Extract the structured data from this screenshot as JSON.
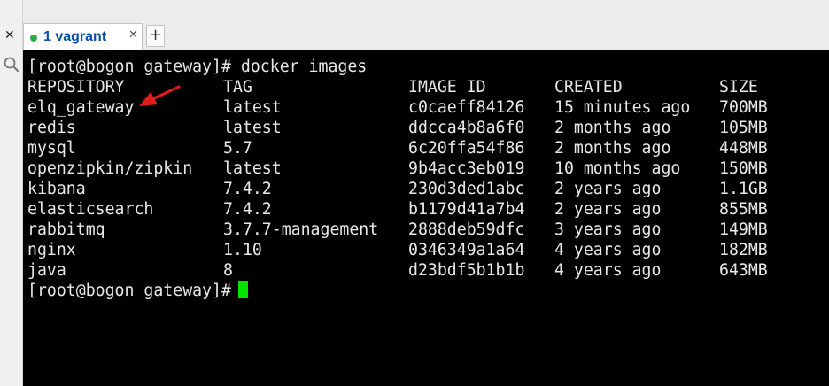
{
  "window": {
    "left_close_glyph": "✕",
    "tab": {
      "number": "1",
      "label": "vagrant",
      "close_glyph": "✕"
    },
    "add_tab_glyph": "+"
  },
  "terminal": {
    "command_line": "[root@bogon gateway]# docker images",
    "headers": [
      "REPOSITORY",
      "TAG",
      "IMAGE ID",
      "CREATED",
      "SIZE"
    ],
    "rows": [
      [
        "elq_gateway",
        "latest",
        "c0caeff84126",
        "15 minutes ago",
        "700MB"
      ],
      [
        "redis",
        "latest",
        "ddcca4b8a6f0",
        "2 months ago",
        "105MB"
      ],
      [
        "mysql",
        "5.7",
        "6c20ffa54f86",
        "2 months ago",
        "448MB"
      ],
      [
        "openzipkin/zipkin",
        "latest",
        "9b4acc3eb019",
        "10 months ago",
        "150MB"
      ],
      [
        "kibana",
        "7.4.2",
        "230d3ded1abc",
        "2 years ago",
        "1.1GB"
      ],
      [
        "elasticsearch",
        "7.4.2",
        "b1179d41a7b4",
        "2 years ago",
        "855MB"
      ],
      [
        "rabbitmq",
        "3.7.7-management",
        "2888deb59dfc",
        "3 years ago",
        "149MB"
      ],
      [
        "nginx",
        "1.10",
        "0346349a1a64",
        "4 years ago",
        "182MB"
      ],
      [
        "java",
        "8",
        "d23bdf5b1b1b",
        "4 years ago",
        "643MB"
      ]
    ],
    "prompt": "[root@bogon gateway]#"
  },
  "colors": {
    "terminal_bg": "#000000",
    "terminal_fg": "#e8e8e8",
    "cursor": "#00e400",
    "annotation_arrow": "#e21b1b",
    "tab_text": "#0a4fa6",
    "status_dot": "#22b14c"
  },
  "icons": {
    "left_close": "close-icon",
    "search": "search-icon",
    "tab_status": "status-dot-icon",
    "tab_close": "close-icon",
    "add_tab": "plus-icon",
    "annotation": "red-arrow-annotation"
  }
}
